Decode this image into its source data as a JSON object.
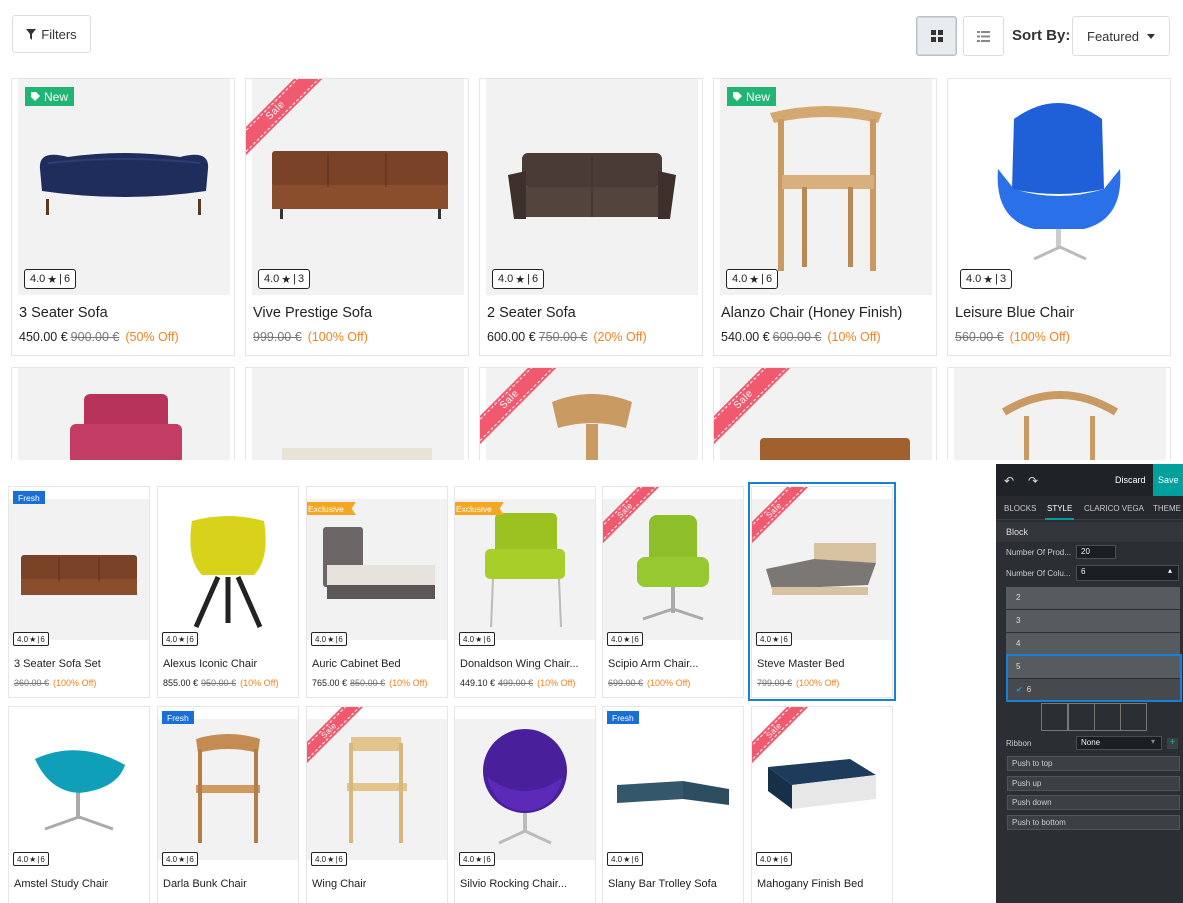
{
  "toolbar": {
    "filters_label": "Filters",
    "sort_by_label": "Sort By:",
    "sort_value": "Featured"
  },
  "products_large": [
    {
      "name": "3 Seater Sofa",
      "rating": "4.0",
      "reviews": "6",
      "price": "450.00 €",
      "old_price": "900.00 €",
      "discount": "(50% Off)",
      "badge": "New"
    },
    {
      "name": "Vive Prestige Sofa",
      "rating": "4.0",
      "reviews": "3",
      "price": "",
      "old_price": "999.00 €",
      "discount": "(100% Off)",
      "badge": "Sale"
    },
    {
      "name": "2 Seater Sofa",
      "rating": "4.0",
      "reviews": "6",
      "price": "600.00 €",
      "old_price": "750.00 €",
      "discount": "(20% Off)",
      "badge": ""
    },
    {
      "name": "Alanzo Chair (Honey Finish)",
      "rating": "4.0",
      "reviews": "6",
      "price": "540.00 €",
      "old_price": "600.00 €",
      "discount": "(10% Off)",
      "badge": "New"
    },
    {
      "name": "Leisure Blue Chair",
      "rating": "4.0",
      "reviews": "3",
      "price": "",
      "old_price": "560.00 €",
      "discount": "(100% Off)",
      "badge": ""
    }
  ],
  "products_row1": [
    {
      "name": "3 Seater Sofa Set",
      "rating": "4.0",
      "reviews": "6",
      "price": "",
      "old_price": "360.00 €",
      "discount": "(100% Off)",
      "badge": "Fresh"
    },
    {
      "name": "Alexus Iconic Chair",
      "rating": "4.0",
      "reviews": "6",
      "price": "855.00 €",
      "old_price": "950.00 €",
      "discount": "(10% Off)",
      "badge": ""
    },
    {
      "name": "Auric Cabinet Bed",
      "rating": "4.0",
      "reviews": "6",
      "price": "765.00 €",
      "old_price": "850.00 €",
      "discount": "(10% Off)",
      "badge": "Exclusive"
    },
    {
      "name": "Donaldson Wing Chair...",
      "rating": "4.0",
      "reviews": "6",
      "price": "449.10 €",
      "old_price": "499.00 €",
      "discount": "(10% Off)",
      "badge": "Exclusive"
    },
    {
      "name": "Scipio Arm Chair...",
      "rating": "4.0",
      "reviews": "6",
      "price": "",
      "old_price": "699.00 €",
      "discount": "(100% Off)",
      "badge": "Sale"
    },
    {
      "name": "Steve Master Bed",
      "rating": "4.0",
      "reviews": "6",
      "price": "",
      "old_price": "799.00 €",
      "discount": "(100% Off)",
      "badge": "Sale"
    }
  ],
  "products_row2": [
    {
      "name": "Amstel Study Chair",
      "rating": "4.0",
      "reviews": "6",
      "badge": ""
    },
    {
      "name": "Darla Bunk Chair",
      "rating": "4.0",
      "reviews": "6",
      "badge": "Fresh"
    },
    {
      "name": "Wing Chair",
      "rating": "4.0",
      "reviews": "6",
      "badge": "Sale"
    },
    {
      "name": "Silvio Rocking Chair...",
      "rating": "4.0",
      "reviews": "6",
      "badge": ""
    },
    {
      "name": "Slany Bar Trolley Sofa",
      "rating": "4.0",
      "reviews": "6",
      "badge": "Fresh"
    },
    {
      "name": "Mahogany Finish Bed",
      "rating": "4.0",
      "reviews": "6",
      "badge": "Sale"
    }
  ],
  "ribbon_label": "Sale",
  "editor": {
    "discard": "Discard",
    "save": "Save",
    "tabs": [
      "BLOCKS",
      "STYLE",
      "CLARICO VEGA",
      "THEME"
    ],
    "section": "Block",
    "num_products_label": "Number Of Prod...",
    "num_products_value": "20",
    "num_columns_label": "Number Of Colu...",
    "num_columns_value": "6",
    "column_options": [
      "2",
      "3",
      "4",
      "5",
      "6"
    ],
    "ribbon_label": "Ribbon",
    "ribbon_value": "None",
    "buttons": [
      "Push to top",
      "Push up",
      "Push down",
      "Push to bottom"
    ]
  },
  "colors": {
    "new_badge": "#21b573",
    "sale_ribbon": "#f05a6e",
    "fresh_badge": "#1a6fd6",
    "exclusive_badge": "#f5a623",
    "discount": "#f58220",
    "editor_accent": "#00a09d",
    "selection": "#1a7fd6"
  }
}
